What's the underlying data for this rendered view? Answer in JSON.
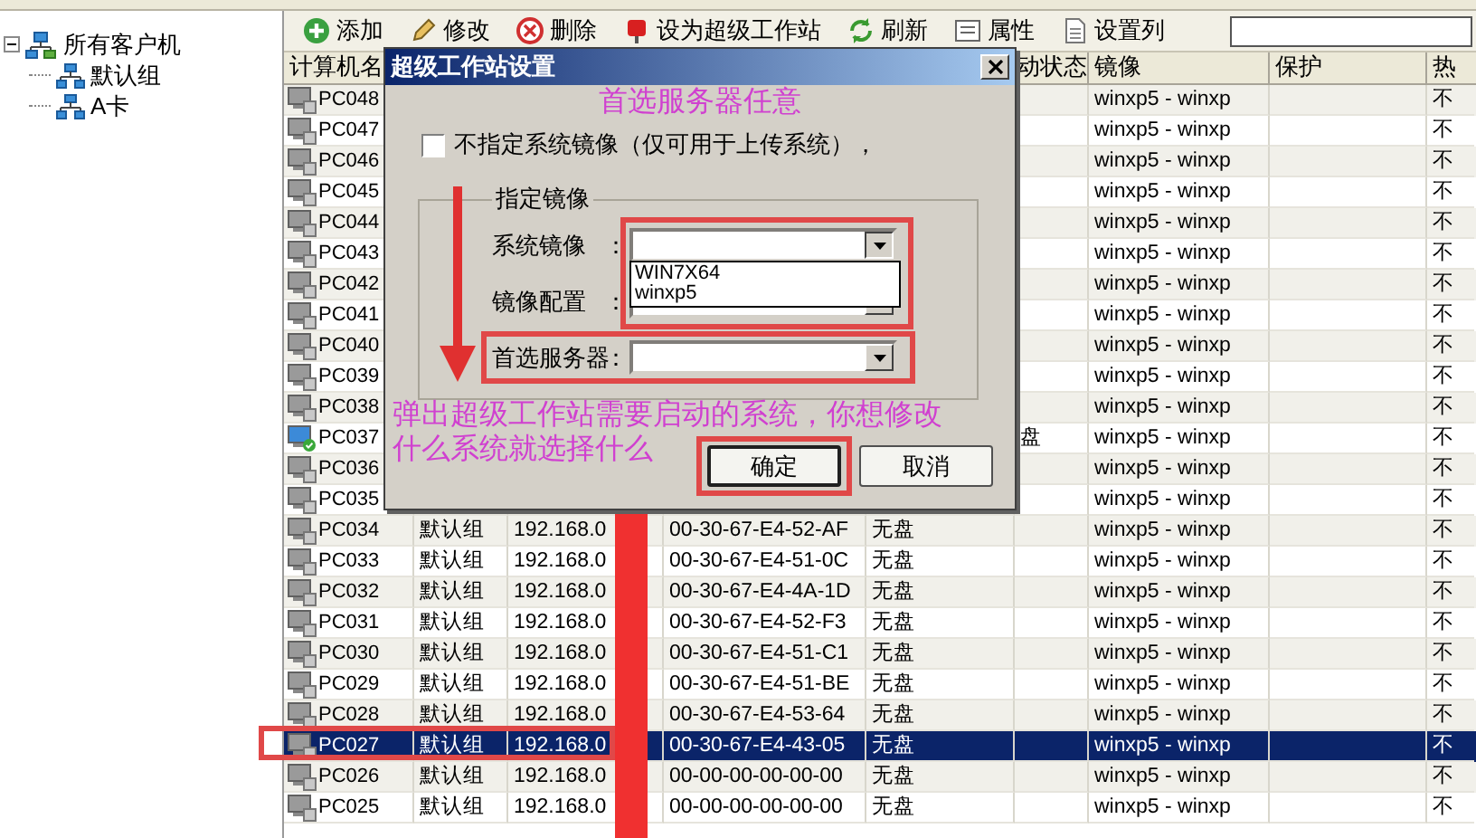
{
  "tree": {
    "label": "所有客户机",
    "expanded": true,
    "children": [
      {
        "label": "默认组"
      },
      {
        "label": "A卡"
      }
    ]
  },
  "toolbar": [
    {
      "kind": "add",
      "label": "添加"
    },
    {
      "kind": "edit",
      "label": "修改"
    },
    {
      "kind": "delete",
      "label": "删除"
    },
    {
      "kind": "super",
      "label": "设为超级工作站"
    },
    {
      "kind": "refresh",
      "label": "刷新"
    },
    {
      "kind": "properties",
      "label": "属性"
    },
    {
      "kind": "columns",
      "label": "设置列"
    }
  ],
  "table": {
    "header": {
      "name": "计算机名",
      "status": "动状态",
      "image": "镜像",
      "protect": "保护",
      "hot": "热"
    },
    "rows": [
      {
        "name": "PC048",
        "kind": "pc",
        "image": "winxp5 - winxp",
        "hot": "不",
        "selected": false
      },
      {
        "name": "PC047",
        "kind": "pc",
        "image": "winxp5 - winxp",
        "hot": "不",
        "selected": false
      },
      {
        "name": "PC046",
        "kind": "pc",
        "image": "winxp5 - winxp",
        "hot": "不",
        "selected": false
      },
      {
        "name": "PC045",
        "kind": "pc",
        "image": "winxp5 - winxp",
        "hot": "不",
        "selected": false
      },
      {
        "name": "PC044",
        "kind": "pc",
        "image": "winxp5 - winxp",
        "hot": "不",
        "selected": false
      },
      {
        "name": "PC043",
        "kind": "pc",
        "image": "winxp5 - winxp",
        "hot": "不",
        "selected": false
      },
      {
        "name": "PC042",
        "kind": "pc",
        "image": "winxp5 - winxp",
        "hot": "不",
        "selected": false
      },
      {
        "name": "PC041",
        "kind": "pc",
        "image": "winxp5 - winxp",
        "hot": "不",
        "selected": false
      },
      {
        "name": "PC040",
        "kind": "pc",
        "image": "winxp5 - winxp",
        "hot": "不",
        "selected": false
      },
      {
        "name": "PC039",
        "kind": "pc",
        "image": "winxp5 - winxp",
        "hot": "不",
        "selected": false
      },
      {
        "name": "PC038",
        "kind": "pc",
        "image": "winxp5 - winxp",
        "hot": "不",
        "selected": false
      },
      {
        "name": "PC037",
        "kind": "pc-ok",
        "status": "盘",
        "image": "winxp5 - winxp",
        "hot": "不",
        "selected": false
      },
      {
        "name": "PC036",
        "kind": "pc",
        "image": "winxp5 - winxp",
        "hot": "不",
        "selected": false
      },
      {
        "name": "PC035",
        "kind": "pc",
        "image": "winxp5 - winxp",
        "hot": "不",
        "selected": false
      },
      {
        "name": "PC034",
        "kind": "pc",
        "group": "默认组",
        "ip": "192.168.0",
        "mac": "00-30-67-E4-52-AF",
        "type": "无盘",
        "image": "winxp5 - winxp",
        "hot": "不",
        "selected": false
      },
      {
        "name": "PC033",
        "kind": "pc",
        "group": "默认组",
        "ip": "192.168.0",
        "mac": "00-30-67-E4-51-0C",
        "type": "无盘",
        "image": "winxp5 - winxp",
        "hot": "不",
        "selected": false
      },
      {
        "name": "PC032",
        "kind": "pc",
        "group": "默认组",
        "ip": "192.168.0",
        "mac": "00-30-67-E4-4A-1D",
        "type": "无盘",
        "image": "winxp5 - winxp",
        "hot": "不",
        "selected": false
      },
      {
        "name": "PC031",
        "kind": "pc",
        "group": "默认组",
        "ip": "192.168.0",
        "mac": "00-30-67-E4-52-F3",
        "type": "无盘",
        "image": "winxp5 - winxp",
        "hot": "不",
        "selected": false
      },
      {
        "name": "PC030",
        "kind": "pc",
        "group": "默认组",
        "ip": "192.168.0",
        "mac": "00-30-67-E4-51-C1",
        "type": "无盘",
        "image": "winxp5 - winxp",
        "hot": "不",
        "selected": false
      },
      {
        "name": "PC029",
        "kind": "pc",
        "group": "默认组",
        "ip": "192.168.0",
        "mac": "00-30-67-E4-51-BE",
        "type": "无盘",
        "image": "winxp5 - winxp",
        "hot": "不",
        "selected": false
      },
      {
        "name": "PC028",
        "kind": "pc",
        "group": "默认组",
        "ip": "192.168.0",
        "mac": "00-30-67-E4-53-64",
        "type": "无盘",
        "image": "winxp5 - winxp",
        "hot": "不",
        "selected": false
      },
      {
        "name": "PC027",
        "kind": "pc",
        "group": "默认组",
        "ip": "192.168.0",
        "mac": "00-30-67-E4-43-05",
        "type": "无盘",
        "image": "winxp5 - winxp",
        "hot": "不",
        "selected": true
      },
      {
        "name": "PC026",
        "kind": "pc",
        "group": "默认组",
        "ip": "192.168.0",
        "mac": "00-00-00-00-00-00",
        "type": "无盘",
        "image": "winxp5 - winxp",
        "hot": "不",
        "selected": false
      },
      {
        "name": "PC025",
        "kind": "pc",
        "group": "默认组",
        "ip": "192.168.0",
        "mac": "00-00-00-00-00-00",
        "type": "无盘",
        "image": "winxp5 - winxp",
        "hot": "不",
        "selected": false
      }
    ]
  },
  "dialog": {
    "title": "超级工作站设置",
    "checkbox": {
      "label": "不指定系统镜像（仅可用于上传系统），",
      "checked": false
    },
    "group_title": "指定镜像",
    "fields": [
      {
        "label": "系统镜像",
        "colon": "：",
        "expanded": true,
        "options": [
          "WIN7X64",
          "winxp5"
        ]
      },
      {
        "label": "镜像配置",
        "colon": "：",
        "expanded": false
      },
      {
        "label": "首选服务器",
        "colon": "：",
        "expanded": false
      }
    ],
    "buttons": [
      {
        "label": "确定",
        "default": true
      },
      {
        "label": "取消",
        "default": false
      }
    ]
  },
  "annotations": {
    "note_top": "首选服务器任意",
    "note_bottom": [
      "弹出超级工作站需要启动的系统，你想修改",
      "什么系统就选择什么"
    ]
  }
}
